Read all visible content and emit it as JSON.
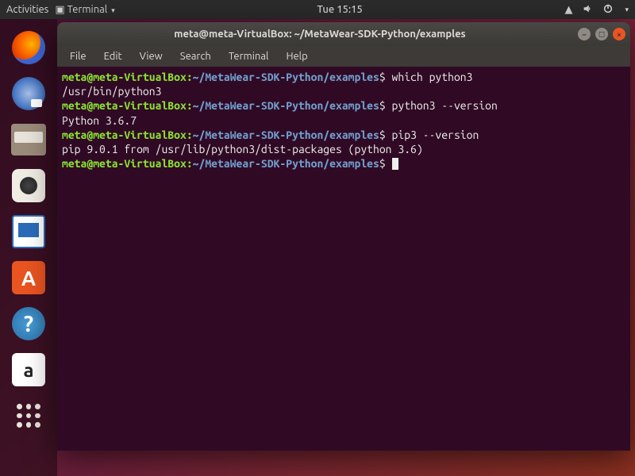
{
  "topbar": {
    "activities": "Activities",
    "app_indicator": "Terminal",
    "datetime": "Tue 15:15"
  },
  "launcher": {
    "items": [
      {
        "name": "firefox"
      },
      {
        "name": "thunderbird"
      },
      {
        "name": "files"
      },
      {
        "name": "rhythmbox"
      },
      {
        "name": "libreoffice-writer"
      },
      {
        "name": "ubuntu-software"
      },
      {
        "name": "help"
      },
      {
        "name": "amazon"
      },
      {
        "name": "show-applications"
      }
    ]
  },
  "window": {
    "title": "meta@meta-VirtualBox: ~/MetaWear-SDK-Python/examples",
    "menu": [
      "File",
      "Edit",
      "View",
      "Search",
      "Terminal",
      "Help"
    ]
  },
  "terminal": {
    "prompt": {
      "user_host": "meta@meta-VirtualBox",
      "colon": ":",
      "path": "~/MetaWear-SDK-Python/examples",
      "symbol": "$"
    },
    "lines": [
      {
        "type": "cmd",
        "text": "which python3"
      },
      {
        "type": "out",
        "text": "/usr/bin/python3"
      },
      {
        "type": "cmd",
        "text": "python3 --version"
      },
      {
        "type": "out",
        "text": "Python 3.6.7"
      },
      {
        "type": "cmd",
        "text": "pip3 --version"
      },
      {
        "type": "out",
        "text": "pip 9.0.1 from /usr/lib/python3/dist-packages (python 3.6)"
      },
      {
        "type": "cmd",
        "text": ""
      }
    ]
  }
}
